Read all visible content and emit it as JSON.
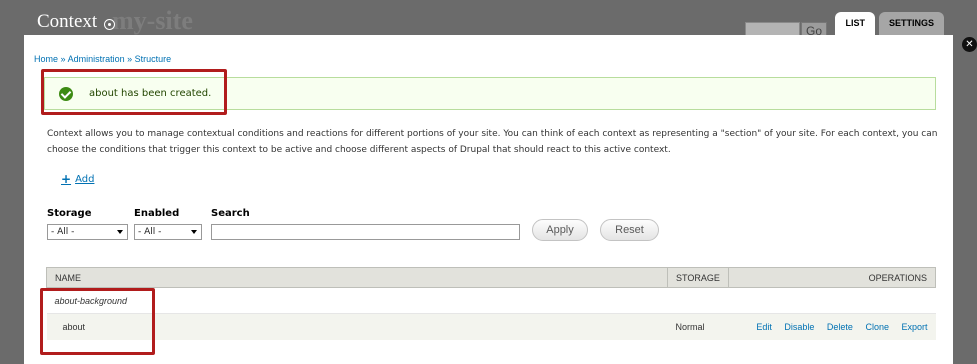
{
  "backdrop": {
    "site_name": "my-site",
    "go_label": "Go"
  },
  "overlay": {
    "title": "Context"
  },
  "tabs": [
    {
      "label": "LIST",
      "active": true
    },
    {
      "label": "SETTINGS",
      "active": false
    }
  ],
  "close_label": "✕",
  "breadcrumb": {
    "items": [
      "Home",
      "Administration",
      "Structure"
    ],
    "separator": "»"
  },
  "status": {
    "message": "about has been created.",
    "color": "#3d8b13"
  },
  "description": "Context allows you to manage contextual conditions and reactions for different portions of your site. You can think of each context as representing a \"section\" of your site. For each context, you can choose the conditions that trigger this context to be active and choose different aspects of Drupal that should react to this active context.",
  "add_link": {
    "label": "Add"
  },
  "filters": {
    "storage": {
      "label": "Storage",
      "selected": "- All -"
    },
    "enabled": {
      "label": "Enabled",
      "selected": "- All -"
    },
    "search": {
      "label": "Search",
      "value": ""
    },
    "apply_label": "Apply",
    "reset_label": "Reset"
  },
  "table": {
    "headers": [
      "NAME",
      "STORAGE",
      "OPERATIONS"
    ],
    "tag": "about-background",
    "rows": [
      {
        "name": "about",
        "storage": "Normal",
        "operations": [
          "Edit",
          "Disable",
          "Delete",
          "Clone",
          "Export"
        ]
      }
    ]
  },
  "highlight_color": "#b11c1c",
  "link_color": "#0071b3"
}
